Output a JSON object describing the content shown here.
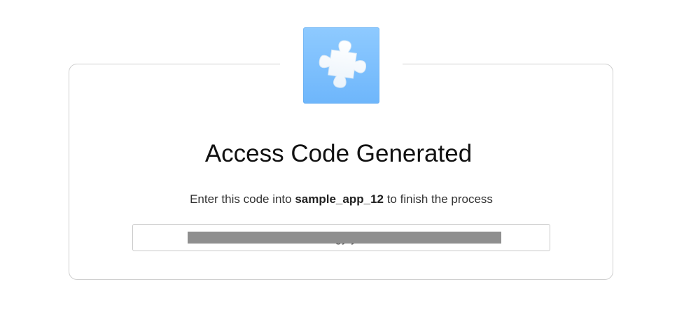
{
  "heading": {
    "title": "Access Code Generated"
  },
  "message": {
    "prefix": "Enter this code into ",
    "app_name": "sample_app_12",
    "suffix": " to finish the process"
  },
  "code": {
    "visible_value": "4n                                                                                  gy      yU",
    "redacted": true
  },
  "logo": {
    "icon": "puzzle-piece-icon",
    "tile_color": "#7fbfff"
  }
}
